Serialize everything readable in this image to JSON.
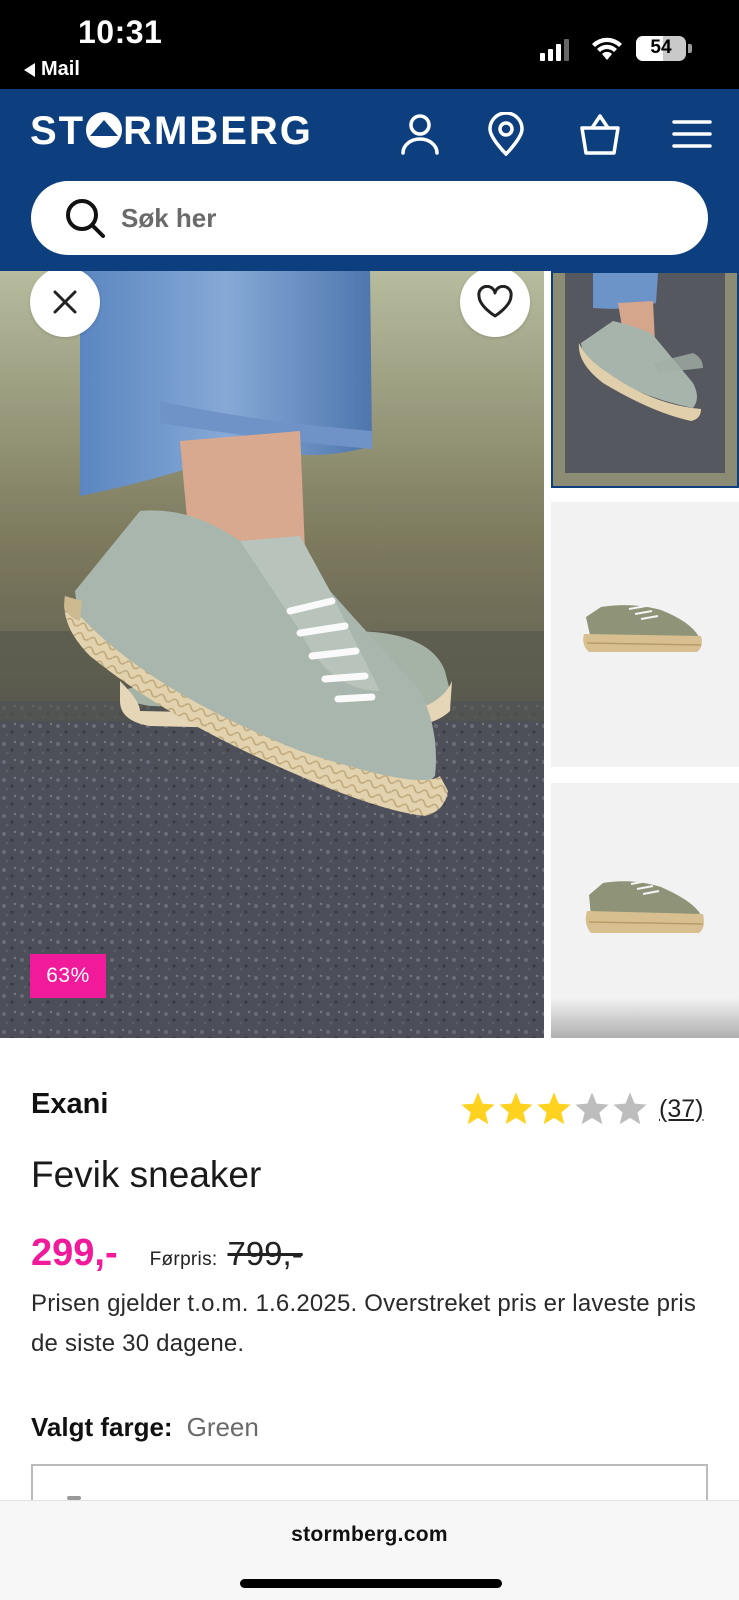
{
  "status_bar": {
    "time": "10:31",
    "back_label": "Mail",
    "battery": "54",
    "battery_level": 0.54
  },
  "header": {
    "logo_text_left": "ST",
    "logo_text_right": "RMBERG",
    "icons": [
      "account-icon",
      "location-pin-icon",
      "shopping-bag-icon",
      "menu-icon"
    ],
    "brand_color": "#0d3f7e"
  },
  "search": {
    "placeholder": "Søk her",
    "value": ""
  },
  "gallery": {
    "discount_badge": "63%",
    "thumbnails": [
      "lifestyle-photo",
      "product-side-photo",
      "product-angle-photo"
    ],
    "selected_thumbnail": 0
  },
  "product": {
    "brand": "Exani",
    "name": "Fevik sneaker",
    "rating": 3,
    "rating_max": 5,
    "review_count": "(37)",
    "price": "299,-",
    "previous_price_label": "Førpris:",
    "previous_price": "799,-",
    "price_note": "Prisen gjelder t.o.m. 1.6.2025. Overstreket pris er laveste pris de siste 30 dagene.",
    "color_label": "Valgt farge:",
    "color_value": "Green",
    "accent_color": "#f01a9a",
    "star_color": "#ffd21f"
  },
  "browser": {
    "url": "stormberg.com"
  }
}
